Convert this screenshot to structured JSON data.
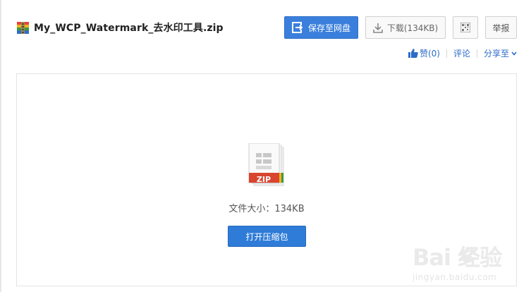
{
  "file": {
    "title": "My_WCP_Watermark_去水印工具.zip",
    "icon": "zip-archive-icon",
    "size_label": "文件大小：134KB",
    "badge": "ZIP"
  },
  "toolbar": {
    "save_label": "保存至网盘",
    "download_label": "下载(134KB)",
    "qr_icon": "qr-code-icon",
    "report_label": "举报"
  },
  "actions": {
    "like_label": "赞(0)",
    "comment_label": "评论",
    "share_label": "分享至"
  },
  "main": {
    "open_label": "打开压缩包"
  },
  "watermark": {
    "main": "Bai 经验",
    "sub": "jingyan.baidu.com"
  },
  "colors": {
    "primary": "#3a7fdc",
    "link": "#2c6bc9",
    "zip_badge": "#d9452f"
  }
}
